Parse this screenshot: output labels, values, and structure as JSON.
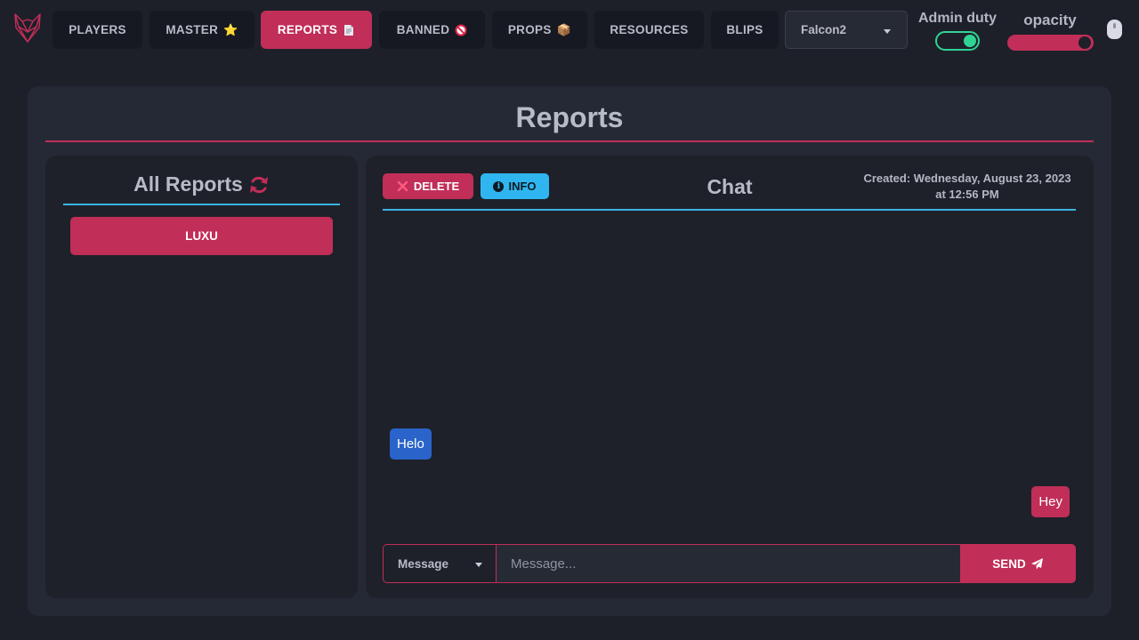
{
  "nav": {
    "items": [
      {
        "label": "PLAYERS",
        "emoji": ""
      },
      {
        "label": "MASTER",
        "emoji": "⭐"
      },
      {
        "label": "REPORTS",
        "emoji": ""
      },
      {
        "label": "BANNED",
        "emoji": ""
      },
      {
        "label": "PROPS",
        "emoji": "📦"
      },
      {
        "label": "RESOURCES",
        "emoji": ""
      },
      {
        "label": "BLIPS",
        "emoji": ""
      }
    ],
    "active": "REPORTS",
    "server_select": "Falcon2",
    "admin_duty_label": "Admin duty",
    "admin_duty_on": true,
    "opacity_label": "opacity",
    "opacity_level": 1.0
  },
  "page": {
    "title": "Reports"
  },
  "reports": {
    "title": "All Reports",
    "items": [
      "LUXU"
    ]
  },
  "chat": {
    "delete_label": "DELETE",
    "info_label": "INFO",
    "title": "Chat",
    "created": "Created: Wednesday, August 23, 2023 at 12:56 PM",
    "messages": [
      {
        "text": "Helo",
        "side": "in"
      },
      {
        "text": "Hey",
        "side": "out"
      }
    ],
    "message_type": "Message",
    "input_placeholder": "Message...",
    "send_label": "SEND"
  },
  "colors": {
    "accent": "#c12e58",
    "info": "#2fb6f0",
    "toggle_on": "#2fd394",
    "incoming_bubble": "#2a63c9",
    "background": "#1d2029",
    "panel": "#252935"
  }
}
